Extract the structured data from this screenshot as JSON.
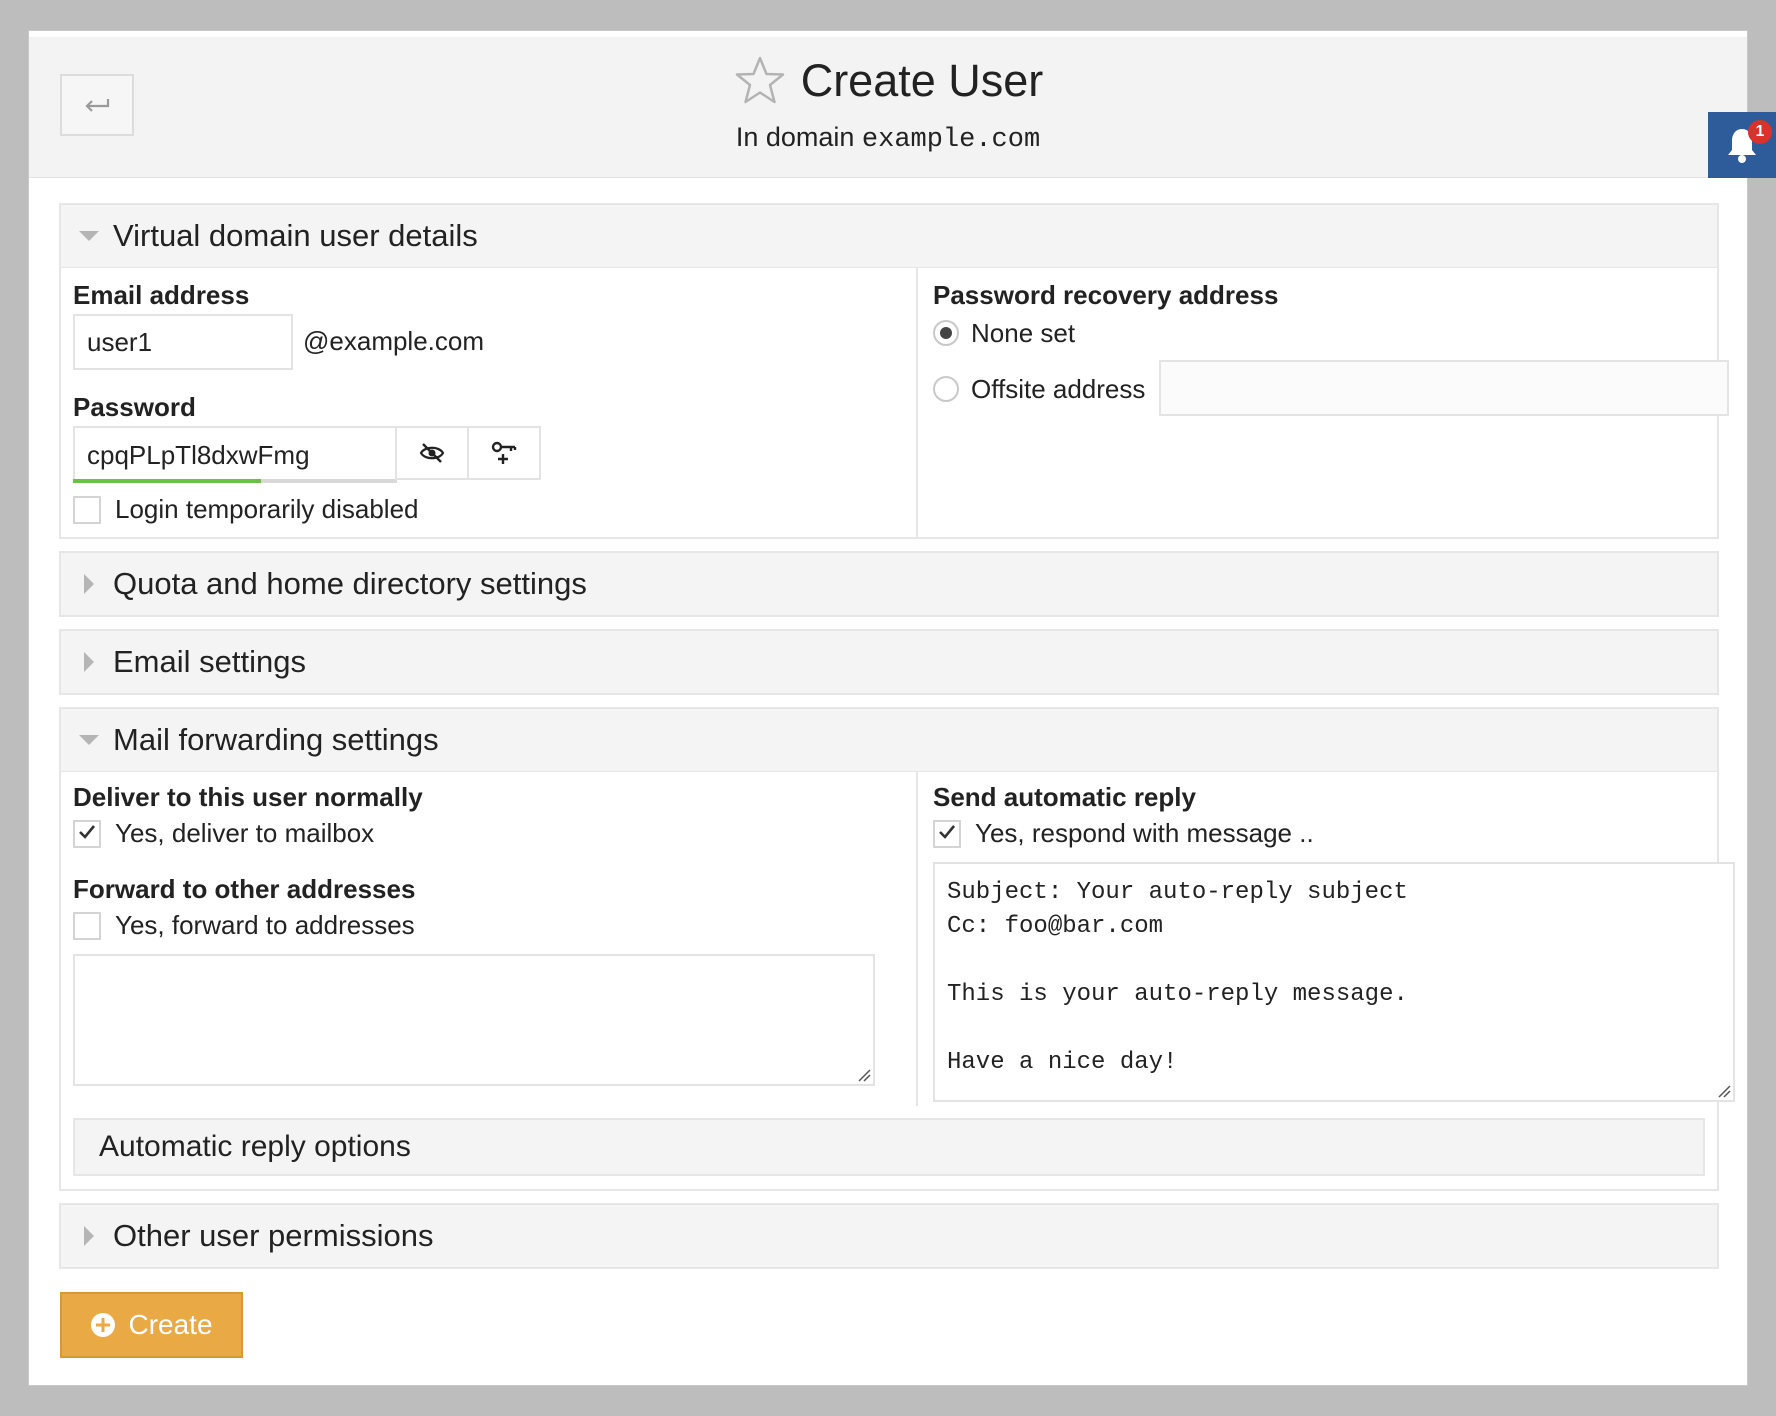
{
  "header": {
    "title": "Create User",
    "subtitle_prefix": "In domain",
    "subtitle_domain": "example.com",
    "back_icon": "return-arrow-icon",
    "star_icon": "star-outline-icon"
  },
  "notifications": {
    "count": "1",
    "icon": "bell-icon"
  },
  "sections": {
    "virtual_domain": {
      "title": "Virtual domain user details",
      "email_label": "Email address",
      "email_value": "user1",
      "email_suffix": "@example.com",
      "password_label": "Password",
      "password_value": "cpqPLpTl8dxwFmg",
      "password_strength": 0.58,
      "toggle_visibility_icon": "eye-off-icon",
      "generate_password_icon": "key-plus-icon",
      "login_disabled_label": "Login temporarily disabled",
      "login_disabled_checked": false,
      "recovery_label": "Password recovery address",
      "recovery_none": "None set",
      "recovery_offsite": "Offsite address",
      "recovery_selected": "None set",
      "offsite_value": ""
    },
    "quota": {
      "title": "Quota and home directory settings"
    },
    "email_settings": {
      "title": "Email settings"
    },
    "forwarding": {
      "title": "Mail forwarding settings",
      "deliver_label": "Deliver to this user normally",
      "deliver_option": "Yes, deliver to mailbox",
      "deliver_checked": true,
      "forward_label": "Forward to other addresses",
      "forward_option": "Yes, forward to addresses",
      "forward_checked": false,
      "forward_addresses": "",
      "autoreply_label": "Send automatic reply",
      "autoreply_option": "Yes, respond with message ..",
      "autoreply_checked": true,
      "autoreply_message": "Subject: Your auto-reply subject\nCc: foo@bar.com\n\nThis is your auto-reply message.\n\nHave a nice day!",
      "autoreply_options_title": "Automatic reply options"
    },
    "permissions": {
      "title": "Other user permissions"
    }
  },
  "actions": {
    "create_label": "Create",
    "create_icon": "plus-circle-icon"
  },
  "colors": {
    "accent": "#e9a944",
    "bell_bg": "#2e5c9a",
    "badge": "#d9312b",
    "strength": "#6cc04a"
  }
}
